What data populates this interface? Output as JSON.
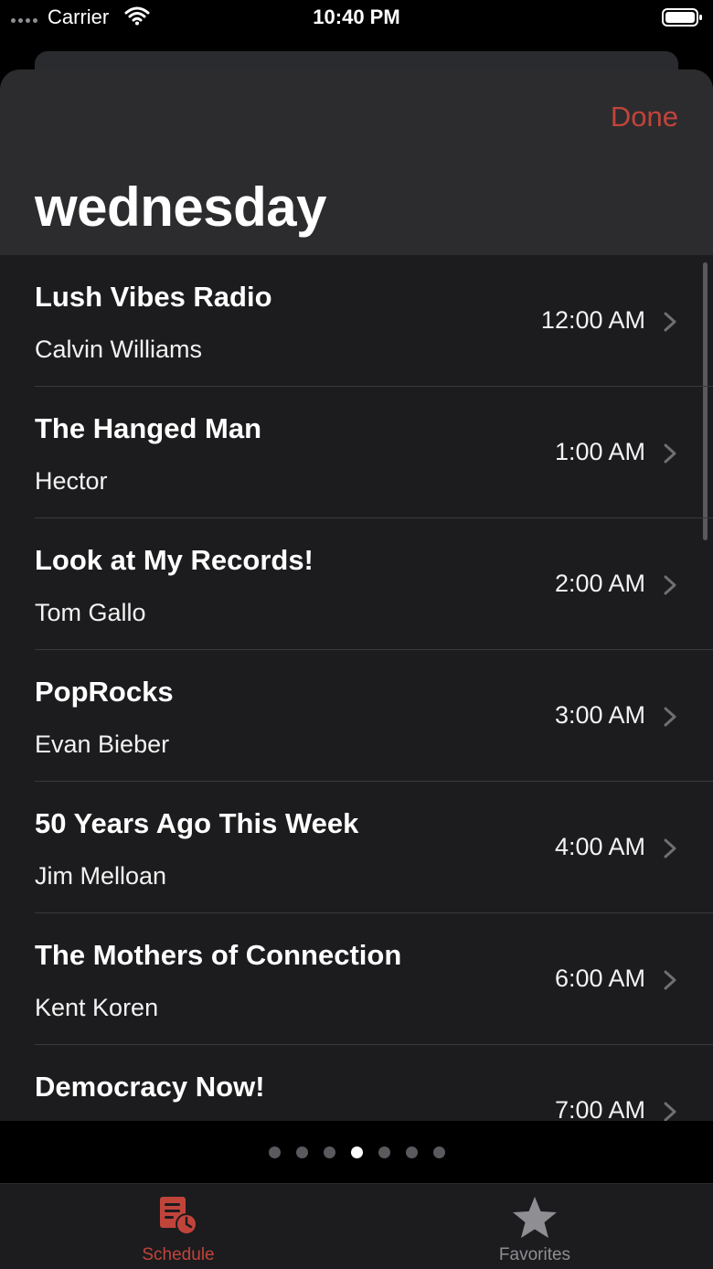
{
  "status_bar": {
    "carrier": "Carrier",
    "time": "10:40 PM"
  },
  "header": {
    "done_label": "Done",
    "title": "wednesday"
  },
  "schedule": [
    {
      "title": "Lush Vibes Radio",
      "host": "Calvin Williams",
      "time": "12:00 AM"
    },
    {
      "title": "The Hanged Man",
      "host": "Hector",
      "time": "1:00 AM"
    },
    {
      "title": "Look at My Records!",
      "host": "Tom Gallo",
      "time": "2:00 AM"
    },
    {
      "title": "PopRocks",
      "host": "Evan Bieber",
      "time": "3:00 AM"
    },
    {
      "title": "50 Years Ago This Week",
      "host": "Jim Melloan",
      "time": "4:00 AM"
    },
    {
      "title": "The Mothers of Connection",
      "host": "Kent Koren",
      "time": "6:00 AM"
    },
    {
      "title": "Democracy Now!",
      "host": "",
      "time": "7:00 AM"
    }
  ],
  "page_indicator": {
    "count": 7,
    "active_index": 3
  },
  "tab_bar": {
    "schedule_label": "Schedule",
    "favorites_label": "Favorites"
  },
  "colors": {
    "accent": "#c1443b",
    "background": "#000000",
    "sheet": "#1c1c1e",
    "header": "#2c2c2e"
  }
}
